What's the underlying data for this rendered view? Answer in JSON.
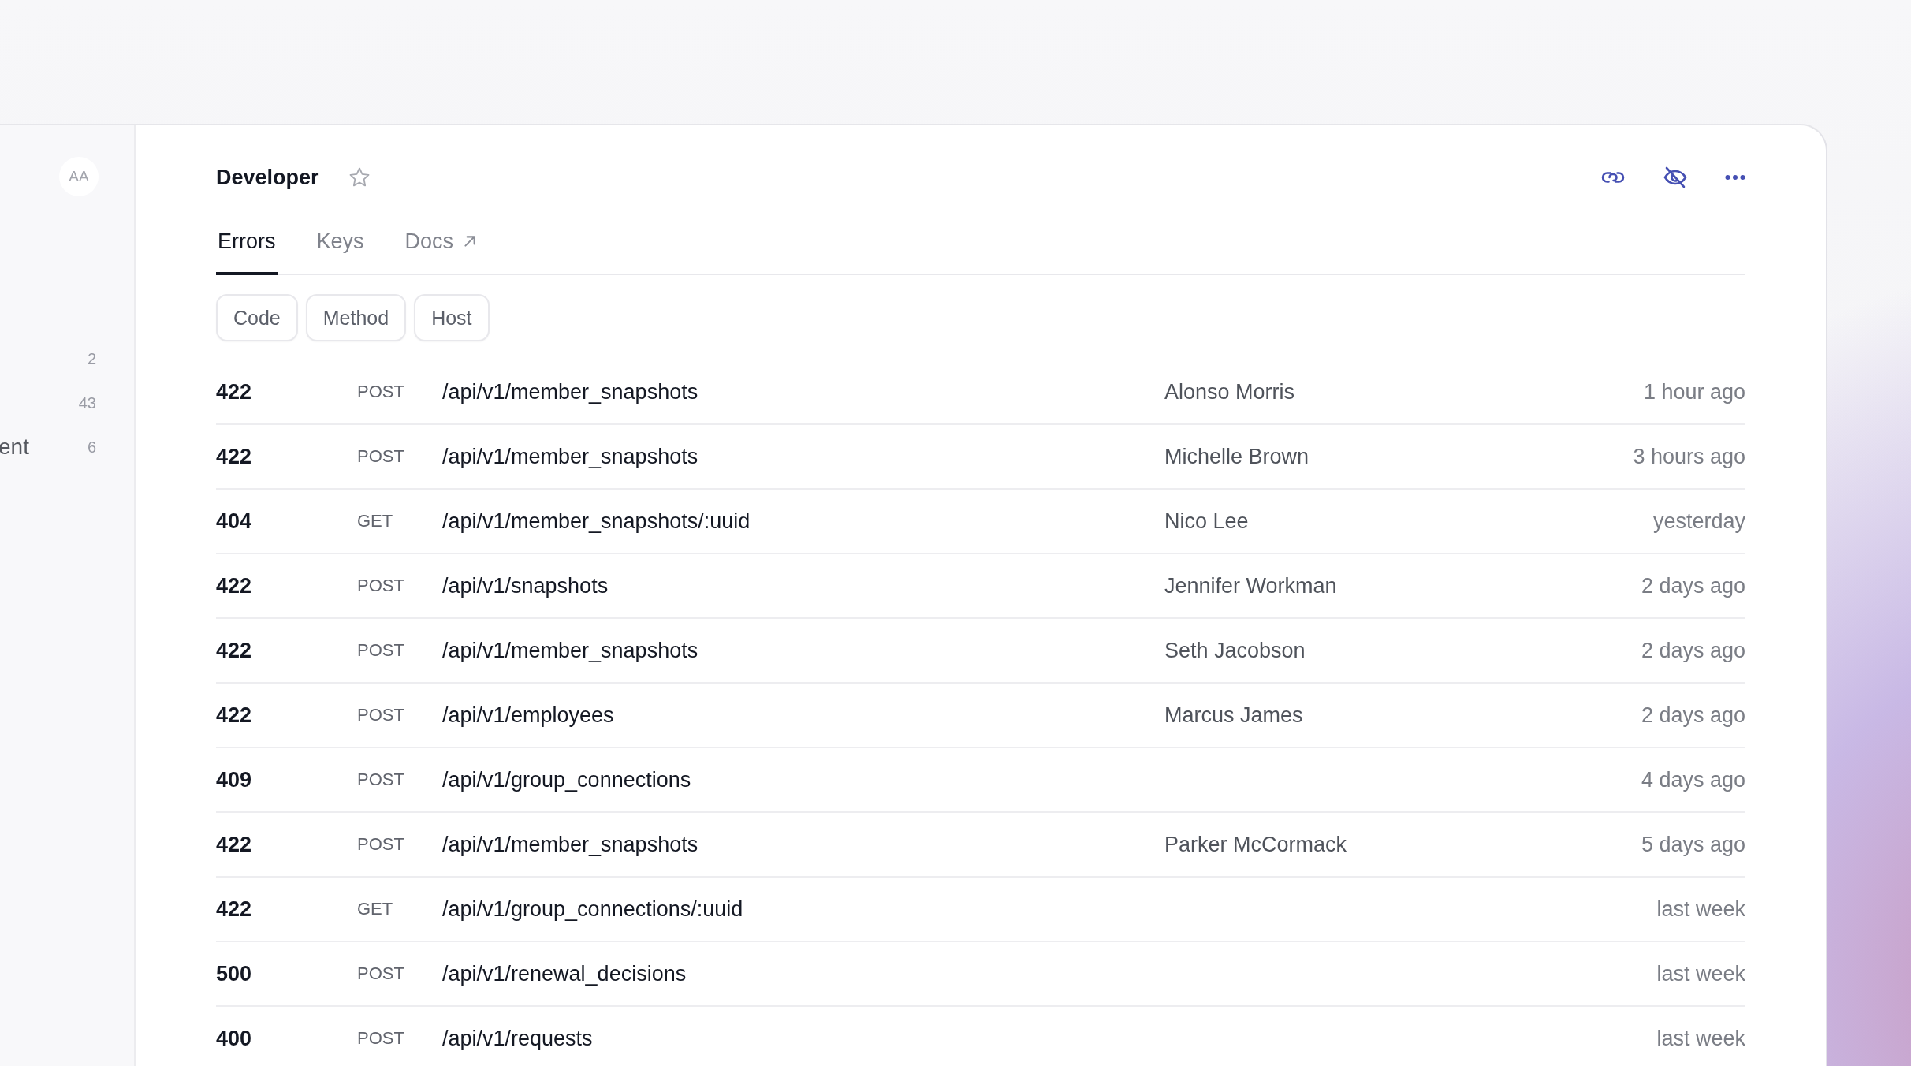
{
  "sidebar": {
    "avatar": "AA",
    "items": [
      {
        "count": "2"
      },
      {
        "count": "43"
      },
      {
        "label": "ent",
        "count": "6"
      }
    ]
  },
  "header": {
    "title": "Developer",
    "starred": false
  },
  "tabs": [
    {
      "label": "Errors",
      "selected": true,
      "external": false
    },
    {
      "label": "Keys",
      "selected": false,
      "external": false
    },
    {
      "label": "Docs",
      "selected": false,
      "external": true
    }
  ],
  "filters": [
    "Code",
    "Method",
    "Host"
  ],
  "rows": [
    {
      "code": "422",
      "method": "POST",
      "path": "/api/v1/member_snapshots",
      "user": "Alonso Morris",
      "time": "1 hour ago"
    },
    {
      "code": "422",
      "method": "POST",
      "path": "/api/v1/member_snapshots",
      "user": "Michelle Brown",
      "time": "3 hours ago"
    },
    {
      "code": "404",
      "method": "GET",
      "path": "/api/v1/member_snapshots/:uuid",
      "user": "Nico Lee",
      "time": "yesterday"
    },
    {
      "code": "422",
      "method": "POST",
      "path": "/api/v1/snapshots",
      "user": "Jennifer Workman",
      "time": "2 days ago"
    },
    {
      "code": "422",
      "method": "POST",
      "path": "/api/v1/member_snapshots",
      "user": "Seth Jacobson",
      "time": "2 days ago"
    },
    {
      "code": "422",
      "method": "POST",
      "path": "/api/v1/employees",
      "user": "Marcus James",
      "time": "2 days ago"
    },
    {
      "code": "409",
      "method": "POST",
      "path": "/api/v1/group_connections",
      "time": "4 days ago"
    },
    {
      "code": "422",
      "method": "POST",
      "path": "/api/v1/member_snapshots",
      "user": "Parker McCormack",
      "time": "5 days ago"
    },
    {
      "code": "422",
      "method": "GET",
      "path": "/api/v1/group_connections/:uuid",
      "time": "last week"
    },
    {
      "code": "500",
      "method": "POST",
      "path": "/api/v1/renewal_decisions",
      "time": "last week"
    },
    {
      "code": "400",
      "method": "POST",
      "path": "/api/v1/requests",
      "time": "last week"
    }
  ]
}
